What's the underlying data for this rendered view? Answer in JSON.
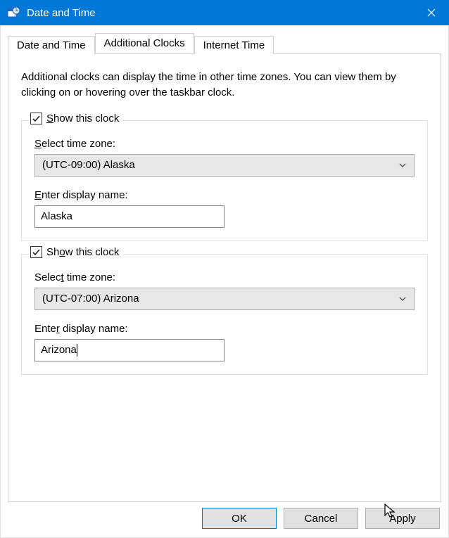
{
  "window": {
    "title": "Date and Time"
  },
  "tabs": {
    "t0": "Date and Time",
    "t1": "Additional Clocks",
    "t2": "Internet Time"
  },
  "description": "Additional clocks can display the time in other time zones. You can view them by clicking on or hovering over the taskbar clock.",
  "clock1": {
    "show_label_pre": "S",
    "show_label_post": "how this clock",
    "select_tz_label_pre": "S",
    "select_tz_label_post": "elect time zone:",
    "tz_value": "(UTC-09:00) Alaska",
    "display_name_label_pre": "E",
    "display_name_label_post": "nter display name:",
    "display_name_value": "Alaska"
  },
  "clock2": {
    "show_label_pre": "Sh",
    "show_label_post": "w this clock",
    "show_label_ul": "o",
    "select_tz_label_pre": "Selec",
    "select_tz_label_ul": "t",
    "select_tz_label_post": " time zone:",
    "tz_value": "(UTC-07:00) Arizona",
    "display_name_label_pre": "Ente",
    "display_name_label_ul": "r",
    "display_name_label_post": " display name:",
    "display_name_value": "Arizona"
  },
  "buttons": {
    "ok": "OK",
    "cancel": "Cancel",
    "apply": "Apply"
  }
}
